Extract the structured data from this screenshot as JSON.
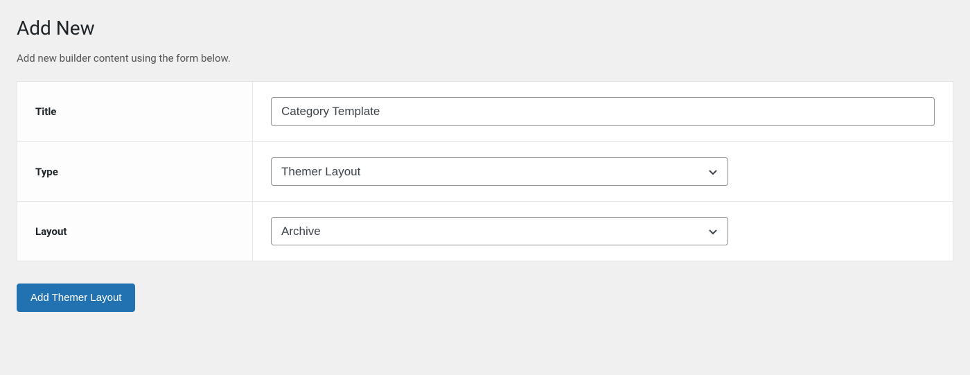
{
  "header": {
    "title": "Add New",
    "description": "Add new builder content using the form below."
  },
  "form": {
    "title": {
      "label": "Title",
      "value": "Category Template"
    },
    "type": {
      "label": "Type",
      "value": "Themer Layout"
    },
    "layout": {
      "label": "Layout",
      "value": "Archive"
    }
  },
  "actions": {
    "submit_label": "Add Themer Layout"
  }
}
